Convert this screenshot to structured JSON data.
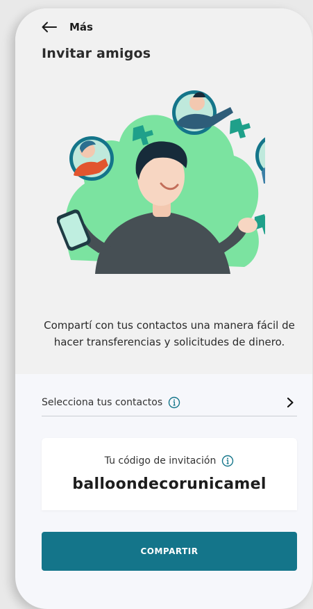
{
  "header": {
    "back_label": "Más",
    "title": "Invitar amigos"
  },
  "hero": {
    "description": "Compartí con tus contactos una manera fácil de hacer transferencias y solicitudes de dinero."
  },
  "contacts": {
    "label": "Selecciona tus contactos"
  },
  "invite_code": {
    "label": "Tu código de invitación",
    "value": "balloondecorunicamel"
  },
  "share_button": {
    "label": "COMPARTIR"
  },
  "colors": {
    "accent": "#14758a",
    "illustration_green": "#7be3a0",
    "avatar_ring": "#1fa08a"
  }
}
